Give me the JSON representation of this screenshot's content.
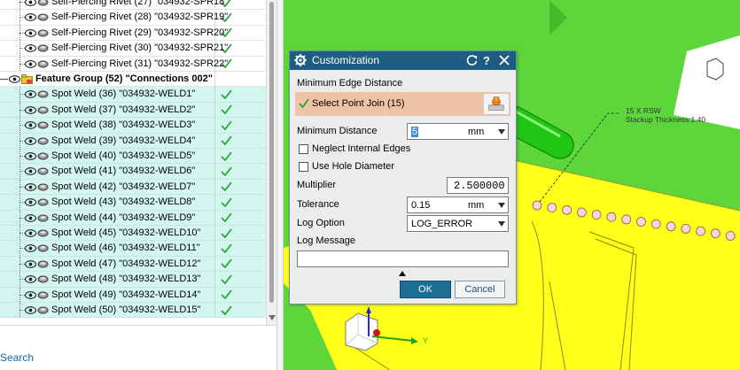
{
  "tree": {
    "spr_rows": [
      {
        "label": "Self-Piercing Rivet (27) \"034932-SPR18\""
      },
      {
        "label": "Self-Piercing Rivet (28) \"034932-SPR19\""
      },
      {
        "label": "Self-Piercing Rivet (29) \"034932-SPR20\""
      },
      {
        "label": "Self-Piercing Rivet (30) \"034932-SPR21\""
      },
      {
        "label": "Self-Piercing Rivet (31) \"034932-SPR22\""
      }
    ],
    "group": {
      "label": "Feature Group (52) \"Connections 002\""
    },
    "weld_rows": [
      {
        "label": "Spot Weld (36) \"034932-WELD1\""
      },
      {
        "label": "Spot Weld (37) \"034932-WELD2\""
      },
      {
        "label": "Spot Weld (38) \"034932-WELD3\""
      },
      {
        "label": "Spot Weld (39) \"034932-WELD4\""
      },
      {
        "label": "Spot Weld (40) \"034932-WELD5\""
      },
      {
        "label": "Spot Weld (41) \"034932-WELD6\""
      },
      {
        "label": "Spot Weld (42) \"034932-WELD7\""
      },
      {
        "label": "Spot Weld (43) \"034932-WELD8\""
      },
      {
        "label": "Spot Weld (44) \"034932-WELD9\""
      },
      {
        "label": "Spot Weld (45) \"034932-WELD10\""
      },
      {
        "label": "Spot Weld (46) \"034932-WELD11\""
      },
      {
        "label": "Spot Weld (47) \"034932-WELD12\""
      },
      {
        "label": "Spot Weld (48) \"034932-WELD13\""
      },
      {
        "label": "Spot Weld (49) \"034932-WELD14\""
      },
      {
        "label": "Spot Weld (50) \"034932-WELD15\""
      }
    ]
  },
  "search": {
    "label": "Search"
  },
  "viewport": {
    "annotation_line1": "15 X RSW",
    "annotation_line2": "Stackup Thickness:1.40",
    "axis_y": "Y",
    "colors": {
      "panel_green": "#5cd63a",
      "panel_yellow": "#ffff1a",
      "tube_green": "#21c514"
    }
  },
  "dialog": {
    "title": "Customization",
    "section_title": "Minimum Edge Distance",
    "select_label": "Select Point Join (15)",
    "min_distance_label": "Minimum Distance",
    "min_distance_value": "5",
    "min_distance_unit": "mm",
    "neglect_label": "Neglect Internal Edges",
    "hole_label": "Use Hole Diameter",
    "multiplier_label": "Multiplier",
    "multiplier_value": "2.500000",
    "tolerance_label": "Tolerance",
    "tolerance_value": "0.15",
    "tolerance_unit": "mm",
    "log_option_label": "Log Option",
    "log_option_value": "LOG_ERROR",
    "log_message_label": "Log Message",
    "log_message_value": "",
    "ok_label": "OK",
    "cancel_label": "Cancel",
    "colors": {
      "title_bar": "#1f5c81",
      "select_highlight": "#efc3a7",
      "ok_button": "#1e6e94"
    }
  }
}
